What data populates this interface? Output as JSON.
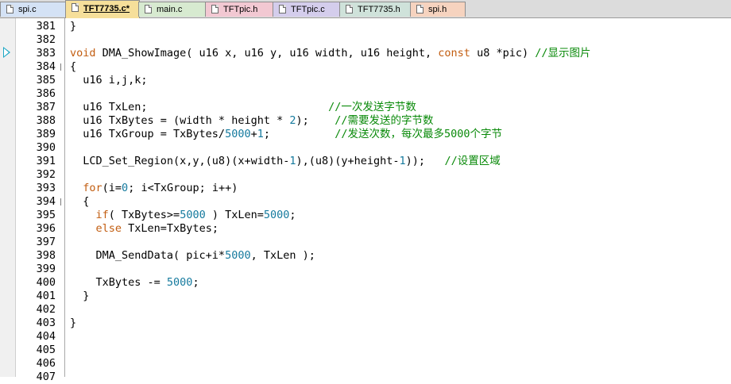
{
  "tabs": [
    {
      "label": "spi.c",
      "color": "#d4e2f5",
      "active": false
    },
    {
      "label": "TFT7735.c*",
      "color": "#f6df9a",
      "active": true
    },
    {
      "label": "main.c",
      "color": "#d7ead0",
      "active": false
    },
    {
      "label": "TFTpic.h",
      "color": "#f2c8d2",
      "active": false
    },
    {
      "label": "TFTpic.c",
      "color": "#d4cdec",
      "active": false
    },
    {
      "label": "TFT7735.h",
      "color": "#cfe2da",
      "active": false
    },
    {
      "label": "spi.h",
      "color": "#f6d3bf",
      "active": false
    }
  ],
  "editor": {
    "current_line_marker": "383",
    "lines": [
      {
        "n": "381",
        "segs": [
          [
            "t",
            "}"
          ]
        ]
      },
      {
        "n": "382",
        "segs": []
      },
      {
        "n": "383",
        "segs": [
          [
            "k",
            "void"
          ],
          [
            "t",
            " DMA_ShowImage( u16 x, u16 y, u16 width, u16 height, "
          ],
          [
            "k",
            "const"
          ],
          [
            "t",
            " u8 *pic) "
          ],
          [
            "c",
            "//显示图片"
          ]
        ]
      },
      {
        "n": "384",
        "segs": [
          [
            "t",
            "{"
          ]
        ]
      },
      {
        "n": "385",
        "segs": [
          [
            "t",
            "  u16 i,j,k;"
          ]
        ]
      },
      {
        "n": "386",
        "segs": []
      },
      {
        "n": "387",
        "segs": [
          [
            "t",
            "  u16 TxLen;                            "
          ],
          [
            "c",
            "//一次发送字节数"
          ]
        ]
      },
      {
        "n": "388",
        "segs": [
          [
            "t",
            "  u16 TxBytes = (width * height * "
          ],
          [
            "n",
            "2"
          ],
          [
            "t",
            ");    "
          ],
          [
            "c",
            "//需要发送的字节数"
          ]
        ]
      },
      {
        "n": "389",
        "segs": [
          [
            "t",
            "  u16 TxGroup = TxBytes/"
          ],
          [
            "n",
            "5000"
          ],
          [
            "t",
            "+"
          ],
          [
            "n",
            "1"
          ],
          [
            "t",
            ";          "
          ],
          [
            "c",
            "//发送次数，每次最多5000个字节"
          ]
        ]
      },
      {
        "n": "390",
        "segs": []
      },
      {
        "n": "391",
        "segs": [
          [
            "t",
            "  LCD_Set_Region(x,y,(u8)(x+width-"
          ],
          [
            "n",
            "1"
          ],
          [
            "t",
            "),(u8)(y+height-"
          ],
          [
            "n",
            "1"
          ],
          [
            "t",
            "));   "
          ],
          [
            "c",
            "//设置区域"
          ]
        ]
      },
      {
        "n": "392",
        "segs": []
      },
      {
        "n": "393",
        "segs": [
          [
            "t",
            "  "
          ],
          [
            "k",
            "for"
          ],
          [
            "t",
            "(i="
          ],
          [
            "n",
            "0"
          ],
          [
            "t",
            "; i<TxGroup; i++)"
          ]
        ]
      },
      {
        "n": "394",
        "segs": [
          [
            "t",
            "  {"
          ]
        ]
      },
      {
        "n": "395",
        "segs": [
          [
            "t",
            "    "
          ],
          [
            "k",
            "if"
          ],
          [
            "t",
            "( TxBytes>="
          ],
          [
            "n",
            "5000"
          ],
          [
            "t",
            " ) TxLen="
          ],
          [
            "n",
            "5000"
          ],
          [
            "t",
            ";"
          ]
        ]
      },
      {
        "n": "396",
        "segs": [
          [
            "t",
            "    "
          ],
          [
            "k",
            "else"
          ],
          [
            "t",
            " TxLen=TxBytes;"
          ]
        ]
      },
      {
        "n": "397",
        "segs": []
      },
      {
        "n": "398",
        "segs": [
          [
            "t",
            "    DMA_SendData( pic+i*"
          ],
          [
            "n",
            "5000"
          ],
          [
            "t",
            ", TxLen );"
          ]
        ]
      },
      {
        "n": "399",
        "segs": []
      },
      {
        "n": "400",
        "segs": [
          [
            "t",
            "    TxBytes -= "
          ],
          [
            "n",
            "5000"
          ],
          [
            "t",
            ";"
          ]
        ]
      },
      {
        "n": "401",
        "segs": [
          [
            "t",
            "  }"
          ]
        ]
      },
      {
        "n": "402",
        "segs": []
      },
      {
        "n": "403",
        "segs": [
          [
            "t",
            "}"
          ]
        ]
      },
      {
        "n": "404",
        "segs": []
      },
      {
        "n": "405",
        "segs": []
      },
      {
        "n": "406",
        "segs": []
      },
      {
        "n": "407",
        "segs": []
      }
    ],
    "fold_markers": [
      "384",
      "394"
    ]
  },
  "colors": {
    "keyword": "#c25d10",
    "number": "#157a9e",
    "comment": "#0a8a0a",
    "arrow": "#1aa6c4"
  }
}
